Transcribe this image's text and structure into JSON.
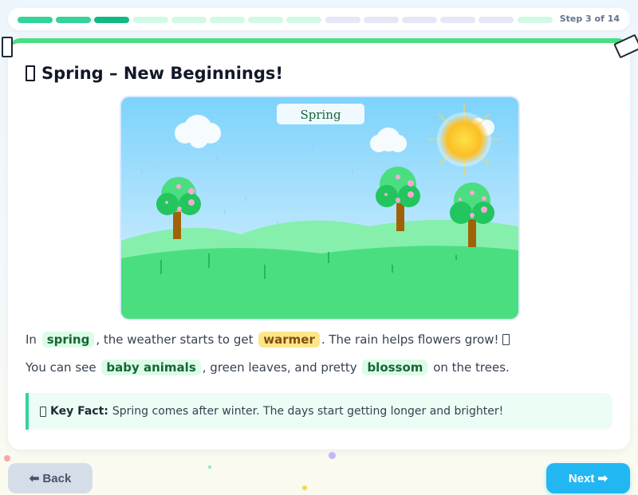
{
  "progress": {
    "step_label": "Step 3 of 14",
    "current": 3,
    "total": 14
  },
  "lesson": {
    "title": "Spring – New Beginnings!",
    "title_icon": "flower-icon",
    "scene_label": "Spring",
    "paragraph1": {
      "before": "In",
      "keyword1": "spring",
      "middle": ", the weather starts to get",
      "keyword2": "warmer",
      "after": ". The rain helps flowers grow!"
    },
    "paragraph2": {
      "before": "You can see",
      "keyword1": "baby animals",
      "middle": ", green leaves, and pretty",
      "keyword2": "blossom",
      "after": "on the trees."
    },
    "key_fact": {
      "label": "Key Fact:",
      "text": "Spring comes after winter. The days start getting longer and brighter!",
      "icon": "lightbulb-icon"
    }
  },
  "nav": {
    "back_label": "⬅ Back",
    "next_label": "Next ➡"
  },
  "colors": {
    "accent_green": "#4ade80",
    "progress_done": "#34d399",
    "next_button": "#22b7f2",
    "keyword_highlight_green": "#dcfce7",
    "keyword_highlight_yellow": "#fde68a"
  }
}
